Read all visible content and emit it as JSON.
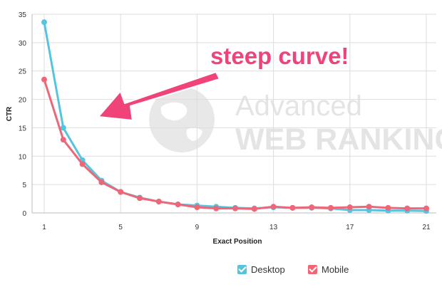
{
  "chart_data": {
    "type": "line",
    "x": [
      1,
      2,
      3,
      4,
      5,
      6,
      7,
      8,
      9,
      10,
      11,
      12,
      13,
      14,
      15,
      16,
      17,
      18,
      19,
      20,
      21
    ],
    "series": [
      {
        "name": "Desktop",
        "color": "#55c4df",
        "values": [
          33.6,
          15.0,
          9.3,
          5.7,
          3.7,
          2.7,
          2.0,
          1.5,
          1.3,
          1.1,
          0.9,
          0.8,
          1.0,
          0.9,
          0.9,
          0.8,
          0.5,
          0.5,
          0.4,
          0.4,
          0.35
        ]
      },
      {
        "name": "Mobile",
        "color": "#ee6677",
        "values": [
          23.5,
          12.9,
          8.6,
          5.4,
          3.7,
          2.6,
          2.0,
          1.5,
          1.0,
          0.8,
          0.8,
          0.7,
          1.1,
          0.9,
          1.0,
          0.9,
          1.0,
          1.1,
          0.9,
          0.8,
          0.8
        ]
      }
    ],
    "xticks": [
      1,
      5,
      9,
      13,
      17,
      21
    ],
    "yticks": [
      0,
      5,
      10,
      15,
      20,
      25,
      30,
      35
    ],
    "xlabel": "Exact Position",
    "ylabel": "CTR",
    "xlim": [
      1,
      21
    ],
    "ylim": [
      0,
      35
    ],
    "grid": true,
    "legend_position": "bottom-right"
  },
  "annotation": {
    "text": "steep curve!",
    "color": "#f0437a"
  },
  "watermark": {
    "line1": "Advanced",
    "line2": "WEB RANKING"
  },
  "legend": {
    "desktop": "Desktop",
    "mobile": "Mobile"
  }
}
